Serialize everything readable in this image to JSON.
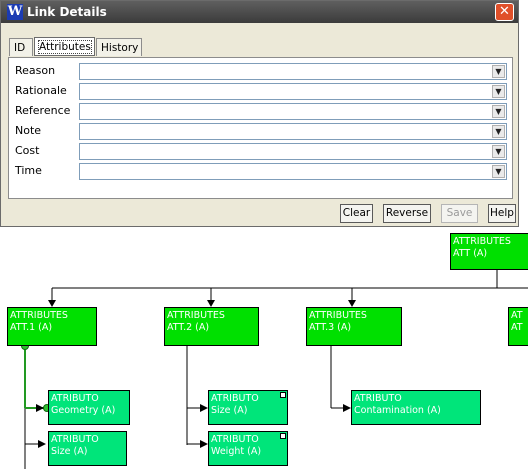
{
  "window": {
    "title": "Link Details",
    "app_icon_letter": "W",
    "close_glyph": "✕"
  },
  "tabs": [
    {
      "label": "ID"
    },
    {
      "label": "Attributes"
    },
    {
      "label": "History"
    }
  ],
  "fields": [
    {
      "label": "Reason",
      "value": ""
    },
    {
      "label": "Rationale",
      "value": ""
    },
    {
      "label": "Reference",
      "value": ""
    },
    {
      "label": "Note",
      "value": ""
    },
    {
      "label": "Cost",
      "value": ""
    },
    {
      "label": "Time",
      "value": ""
    }
  ],
  "buttons": {
    "clear": "Clear",
    "reverse": "Reverse",
    "save": "Save",
    "help": "Help"
  },
  "icons": {
    "combo_arrow": "chevron-down-icon"
  },
  "colors": {
    "attribute_node": "#00e000",
    "atributo_node": "#00e57a",
    "titlebar": "#4a4a4a"
  },
  "diagram": {
    "root": {
      "line1": "ATTRIBUTES",
      "line2": "ATT (A)"
    },
    "groups": [
      {
        "line1": "ATTRIBUTES",
        "line2": "ATT.1 (A)"
      },
      {
        "line1": "ATTRIBUTES",
        "line2": "ATT.2 (A)"
      },
      {
        "line1": "ATTRIBUTES",
        "line2": "ATT.3 (A)"
      },
      {
        "line1": "AT",
        "line2": "AT"
      }
    ],
    "leaves": [
      {
        "line1": "ATRIBUTO",
        "line2": "Geometry (A)"
      },
      {
        "line1": "ATRIBUTO",
        "line2": "Size (A)"
      },
      {
        "line1": "ATRIBUTO",
        "line2": "Size (A)"
      },
      {
        "line1": "ATRIBUTO",
        "line2": "Weight (A)"
      },
      {
        "line1": "ATRIBUTO",
        "line2": "Contamination (A)"
      }
    ]
  }
}
